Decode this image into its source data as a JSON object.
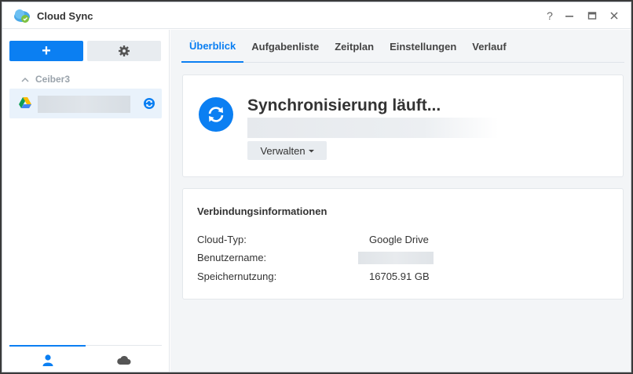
{
  "window": {
    "title": "Cloud Sync"
  },
  "titlebar": {
    "help": "?",
    "minimize": "—",
    "maximize": "▭",
    "close": "✕"
  },
  "sidebar": {
    "add_label": "+",
    "group_name": "Ceiber3",
    "bottom_tabs": [
      {
        "icon": "user-icon"
      },
      {
        "icon": "cloud-icon"
      }
    ]
  },
  "tabs": [
    "Überblick",
    "Aufgabenliste",
    "Zeitplan",
    "Einstellungen",
    "Verlauf"
  ],
  "status": {
    "title": "Synchronisierung läuft...",
    "manage_label": "Verwalten"
  },
  "connection": {
    "title": "Verbindungsinformationen",
    "rows": [
      {
        "label": "Cloud-Typ:",
        "value": "Google Drive"
      },
      {
        "label": "Benutzername:",
        "value": ""
      },
      {
        "label": "Speichernutzung:",
        "value": "16705.91 GB"
      }
    ]
  },
  "colors": {
    "accent": "#0b7ff2",
    "panel": "#f3f5f7"
  }
}
